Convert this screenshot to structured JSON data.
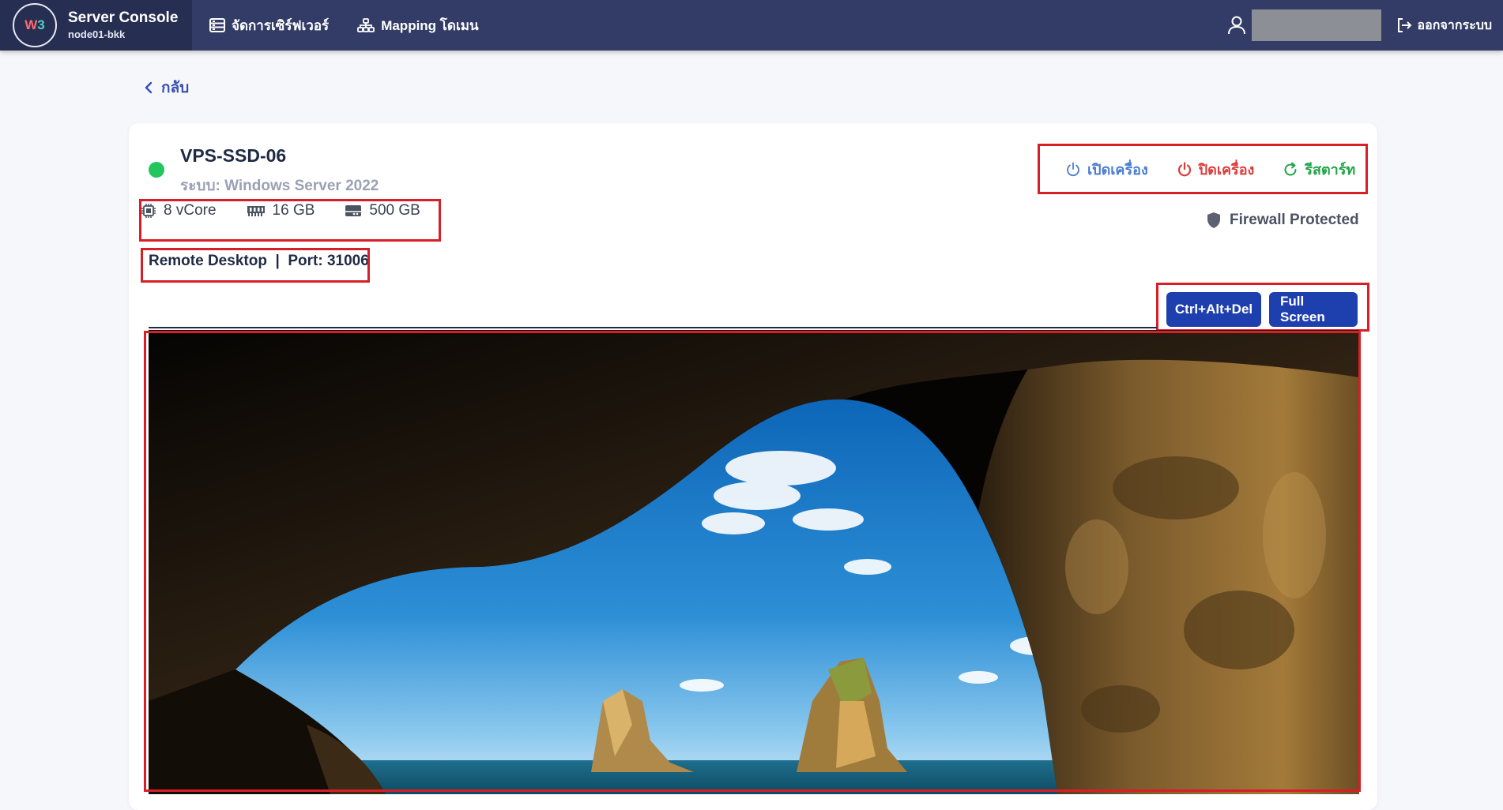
{
  "navbar": {
    "logo_w": "W",
    "logo_3": "3",
    "title": "Server Console",
    "subtitle": "node01-bkk",
    "nav_servers": "จัดการเซิร์ฟเวอร์",
    "nav_mapping": "Mapping โดเมน",
    "logout": "ออกจากระบบ"
  },
  "back": {
    "label": "กลับ"
  },
  "server": {
    "name": "VPS-SSD-06",
    "os": "ระบบ: Windows Server 2022",
    "status_color": "#22c55e",
    "cpu": "8 vCore",
    "ram": "16 GB",
    "disk": "500 GB",
    "connection": "Remote Desktop  |  Port: 31006",
    "firewall": "Firewall Protected"
  },
  "power": {
    "on": "เปิดเครื่อง",
    "off": "ปิดเครื่อง",
    "restart": "รีสตาร์ท"
  },
  "actions": {
    "ctrl_alt_del": "Ctrl+Alt+Del",
    "full_screen": "Full Screen"
  },
  "colors": {
    "navbar": "#333c66",
    "accent_blue": "#1e40af",
    "highlight": "#d81e27"
  }
}
